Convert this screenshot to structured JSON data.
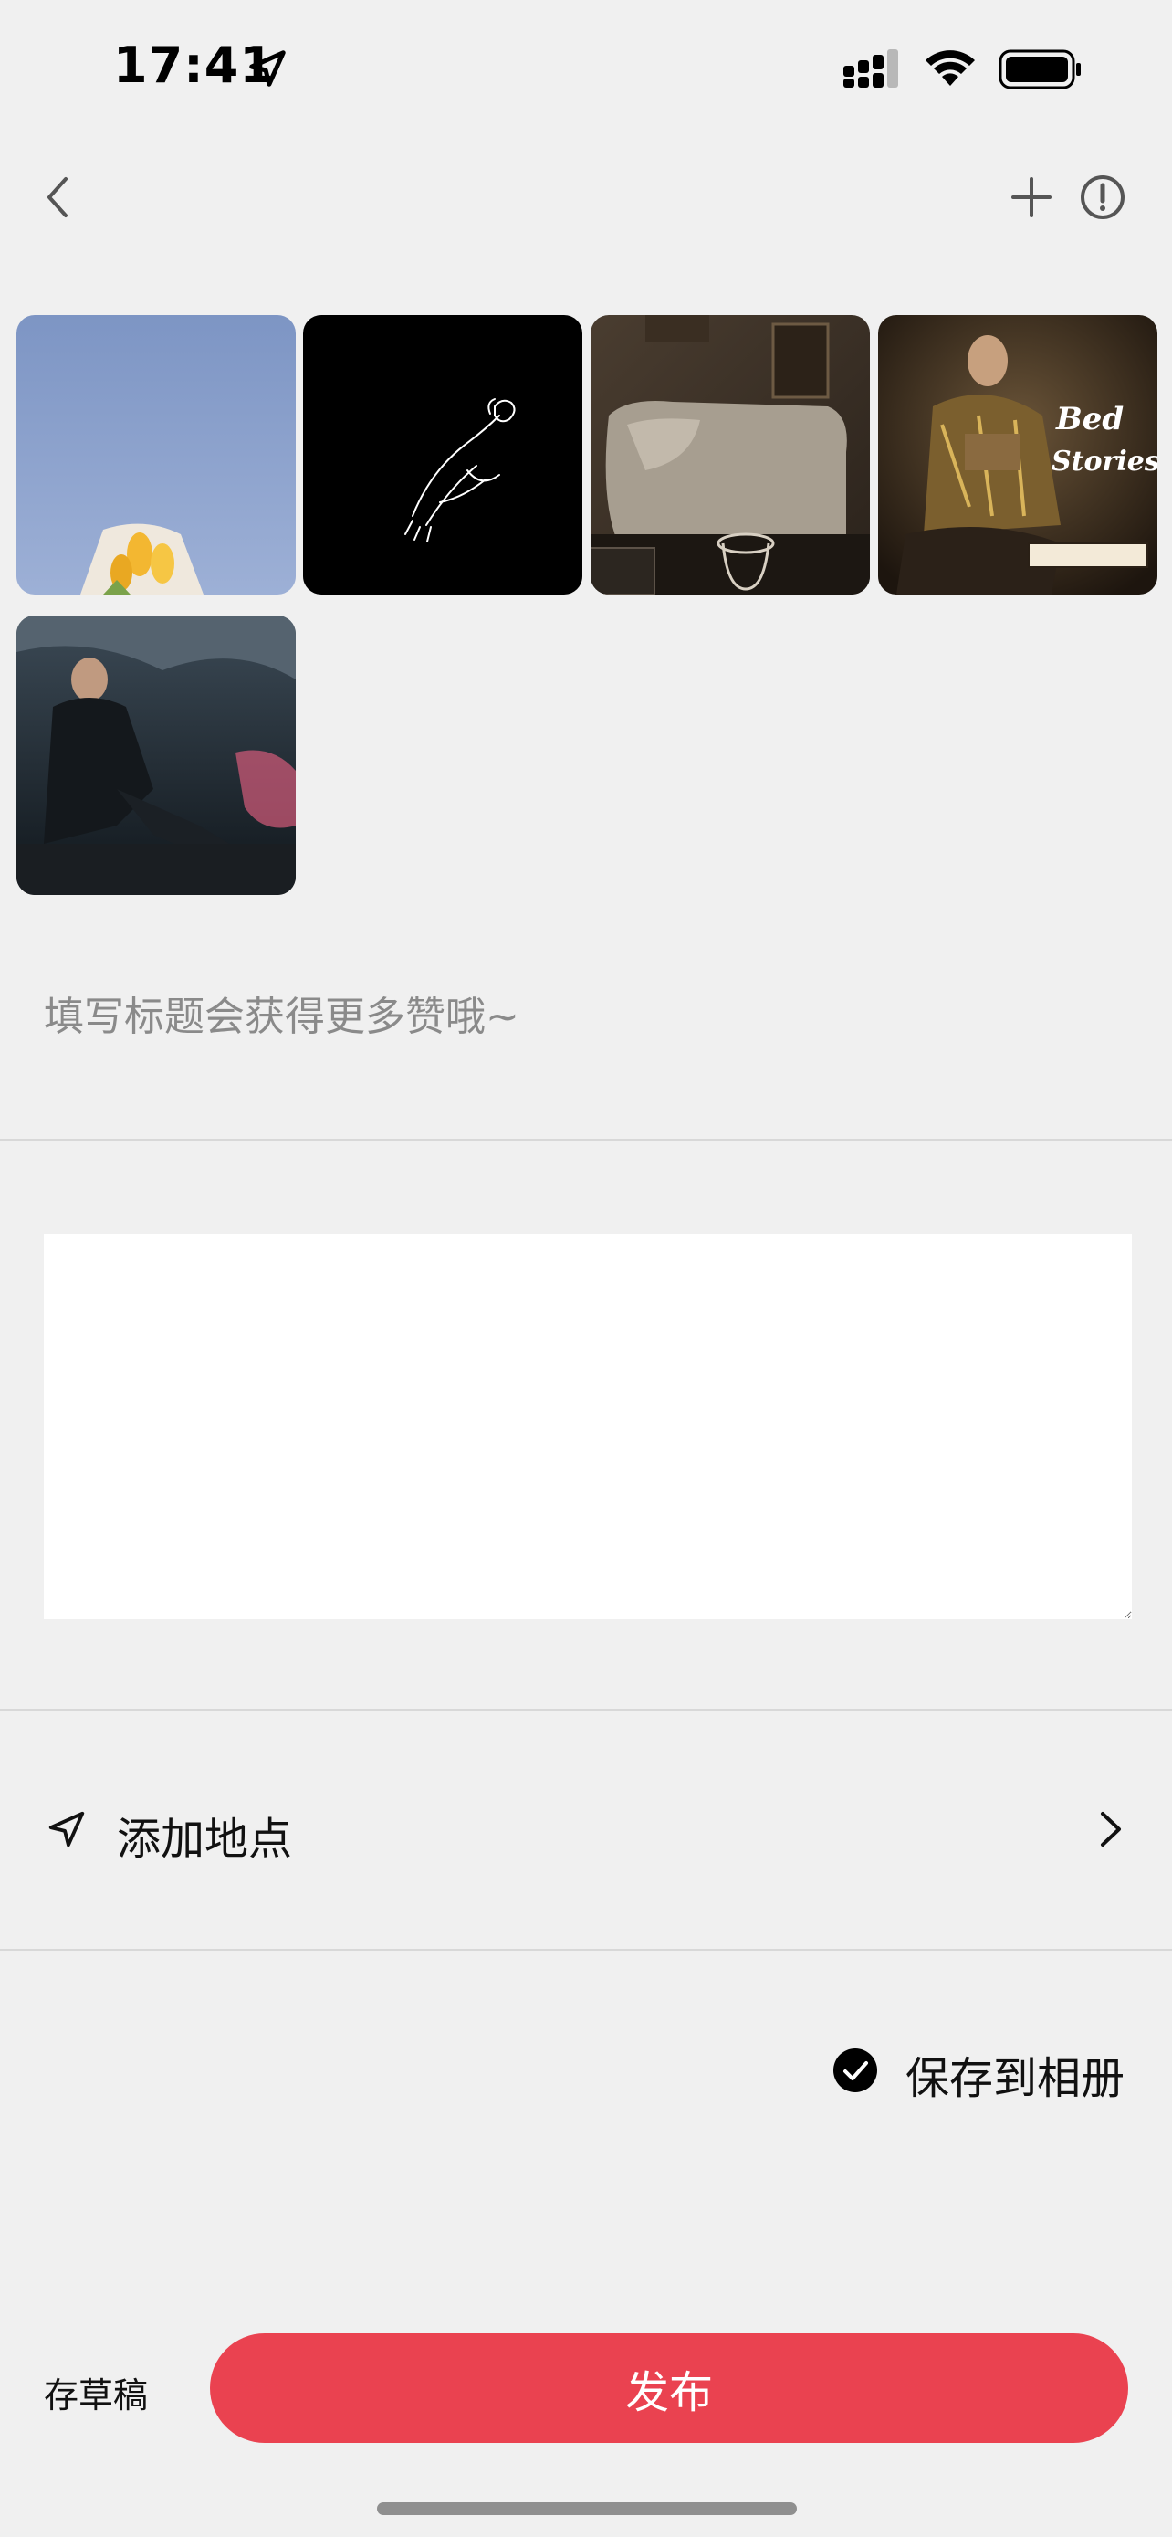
{
  "status_bar": {
    "time": "17:41",
    "icons": [
      "location-arrow-icon",
      "cellular-signal-icon",
      "wifi-icon",
      "battery-icon"
    ]
  },
  "nav": {
    "icons": [
      "back-chevron-icon",
      "plus-icon",
      "info-circle-icon"
    ]
  },
  "images": [
    {
      "name": "photo-tulips-blue-sky"
    },
    {
      "name": "photo-hands-flower-line-art"
    },
    {
      "name": "photo-cozy-living-room"
    },
    {
      "name": "photo-bedtime-stories-album"
    },
    {
      "name": "photo-cross-era-album"
    }
  ],
  "title_field": {
    "value": "",
    "placeholder": "填写标题会获得更多赞哦~"
  },
  "body_field": {
    "value": ""
  },
  "location": {
    "label": "添加地点"
  },
  "save_album": {
    "label": "保存到相册",
    "checked": true
  },
  "bottom_bar": {
    "draft_label": "存草稿",
    "publish_label": "发布"
  },
  "colors": {
    "background": "#f0f0f0",
    "publish_button": "#ea4250",
    "divider": "#d8d8d8"
  }
}
